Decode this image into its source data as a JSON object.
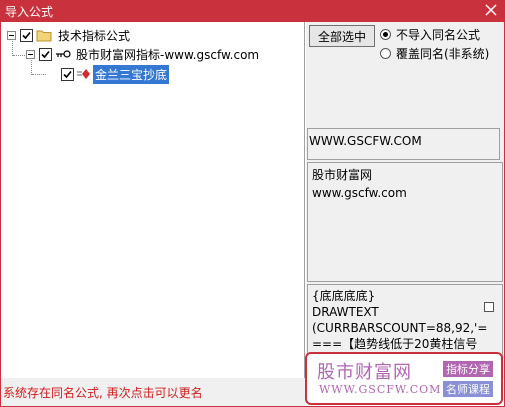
{
  "window": {
    "title": "导入公式"
  },
  "tree": {
    "root": {
      "label": "技术指标公式",
      "checked": true
    },
    "child": {
      "label": "股市财富网指标-www.gscfw.com",
      "checked": true
    },
    "leaf": {
      "label": "金兰三宝抄底",
      "checked": true,
      "selected": true
    }
  },
  "options": {
    "select_all_label": "全部选中",
    "radio_skip_label": "不导入同名公式",
    "radio_overwrite_label": "覆盖同名(非系统)",
    "selected_radio": "skip"
  },
  "info": {
    "url": "WWW.GSCFW.COM",
    "desc_line1": "股市财富网",
    "desc_line2": "www.gscfw.com"
  },
  "code": {
    "line1": "{底底底底}",
    "line2": "DRAWTEXT",
    "line3": "(CURRBARSCOUNT=88,92,'=",
    "line4": "===【趋势线低于20黄柱信号"
  },
  "watermark": {
    "brand": "股市财富网",
    "url": "WWW.GSCFW.COM",
    "tag1": "指标分享",
    "tag2": "名师课程"
  },
  "status": {
    "message": "系统存在同名公式, 再次点击可以更名"
  },
  "colors": {
    "titlebar": "#c9323d",
    "selection": "#3478d4",
    "status_text": "#d21e1e",
    "watermark": "#b266b2"
  }
}
